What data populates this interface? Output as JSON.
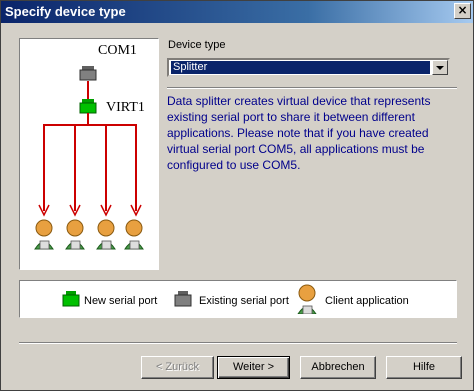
{
  "window": {
    "title": "Specify device type",
    "close_glyph": "×"
  },
  "diagram": {
    "source_label": "COM1",
    "virtual_label": "VIRT1",
    "client_count": 4,
    "arrow_color": "#cc0000"
  },
  "device_type": {
    "label": "Device type",
    "selected": "Splitter",
    "description": "Data splitter creates virtual device that represents existing serial port to share it between different applications. Please note that if you have created virtual serial port COM5, all applications must be configured to use COM5."
  },
  "legend": {
    "new_port": "New serial port",
    "existing_port": "Existing serial port",
    "client_app": "Client application"
  },
  "buttons": {
    "back": "< Zurück",
    "next": "Weiter >",
    "cancel": "Abbrechen",
    "help": "Hilfe"
  },
  "colors": {
    "new_port": "#00c000",
    "existing_port": "#808080",
    "client": "#e8a040",
    "desc_text": "#00008b"
  }
}
